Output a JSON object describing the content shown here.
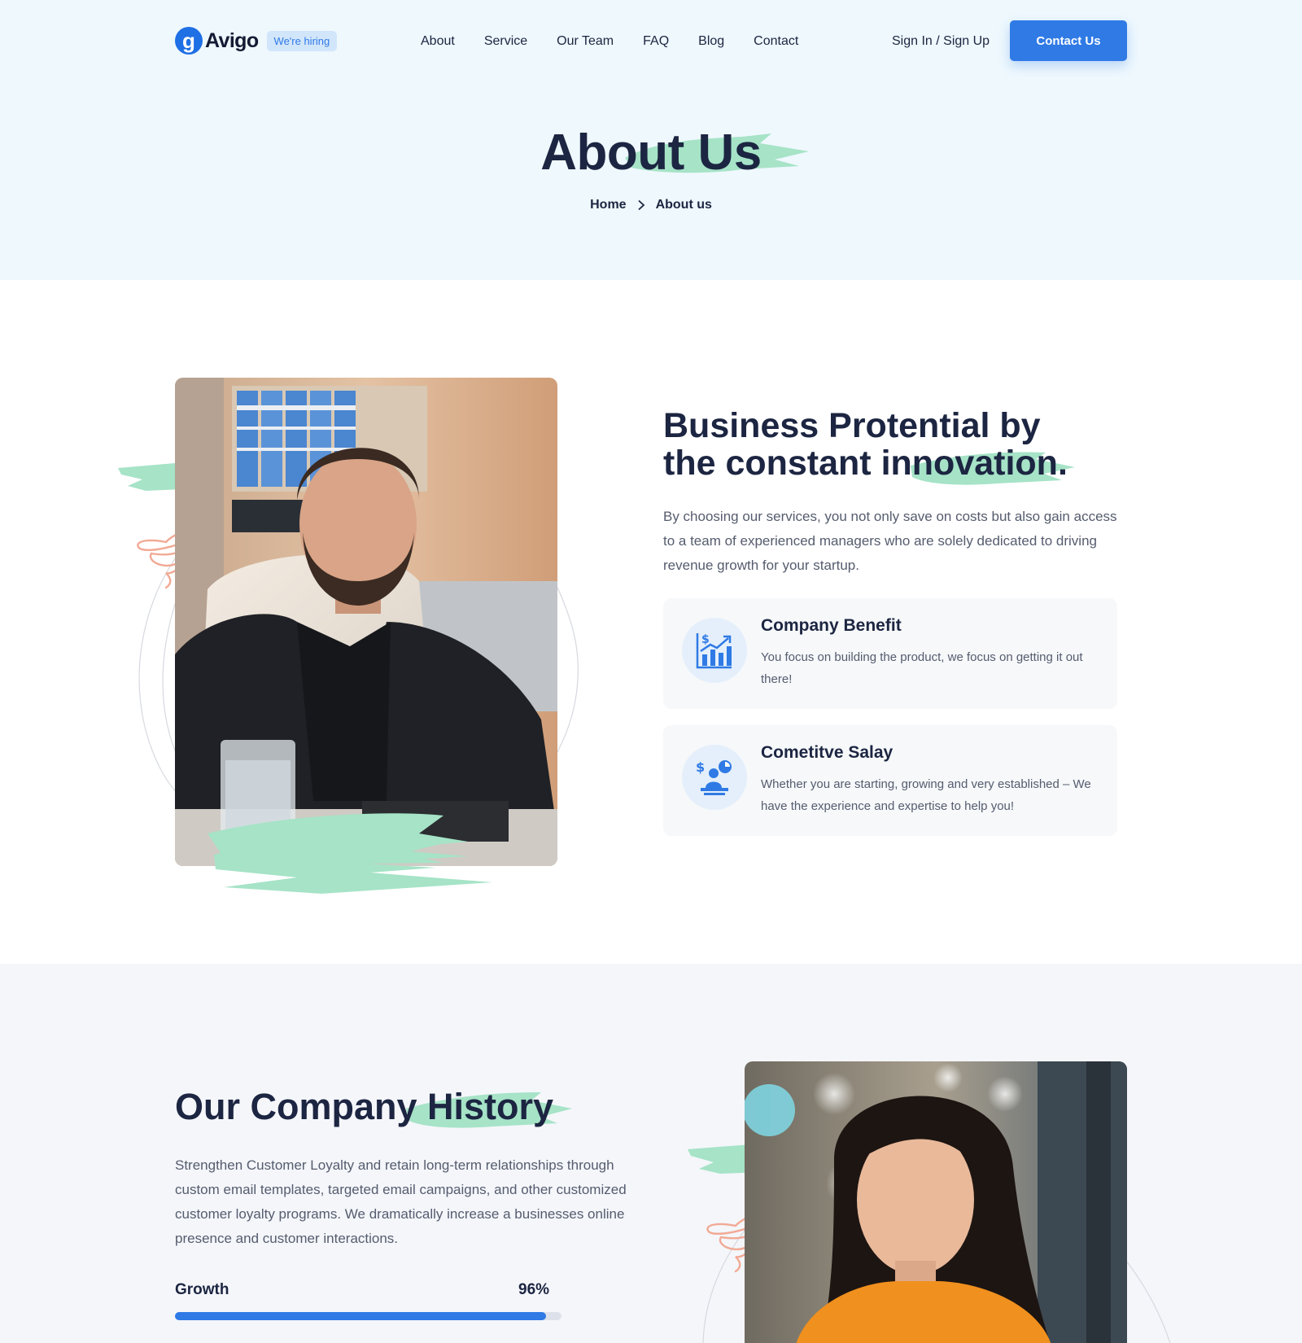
{
  "header": {
    "logo_glyph": "g",
    "logo_text": "Avigo",
    "hiring_badge": "We're hiring",
    "nav": [
      "About",
      "Service",
      "Our Team",
      "FAQ",
      "Blog",
      "Contact"
    ],
    "signin_label": "Sign In / Sign Up",
    "cta_label": "Contact Us"
  },
  "hero": {
    "title": "About Us",
    "breadcrumb": [
      "Home",
      "About us"
    ]
  },
  "about": {
    "heading_line1": "Business Protential by",
    "heading_line2": "the constant innovation.",
    "description": "By choosing our services, you not only save on costs but also gain access to a team of experienced managers who are solely dedicated to driving revenue growth for your startup.",
    "cards": [
      {
        "title": "Company Benefit",
        "text": "You focus on building the product, we focus on getting it out there!",
        "icon": "chart-growth-icon"
      },
      {
        "title": "Cometitve Salay",
        "text": "Whether you are starting, growing and very established – We have the experience and expertise to help you!",
        "icon": "salary-person-icon"
      }
    ]
  },
  "history": {
    "heading": "Our Company History",
    "description": "Strengthen Customer Loyalty and retain long-term relationships through custom email templates, targeted email campaigns, and other customized customer loyalty programs. We dramatically increase a businesses online presence and customer interactions.",
    "progress": {
      "label": "Growth",
      "value_text": "96%",
      "value": 0.96
    }
  },
  "colors": {
    "accent": "#2f7ae5",
    "hero_bg": "#eef8fd",
    "brush": "#a6e3c7",
    "heading": "#1c2541"
  }
}
